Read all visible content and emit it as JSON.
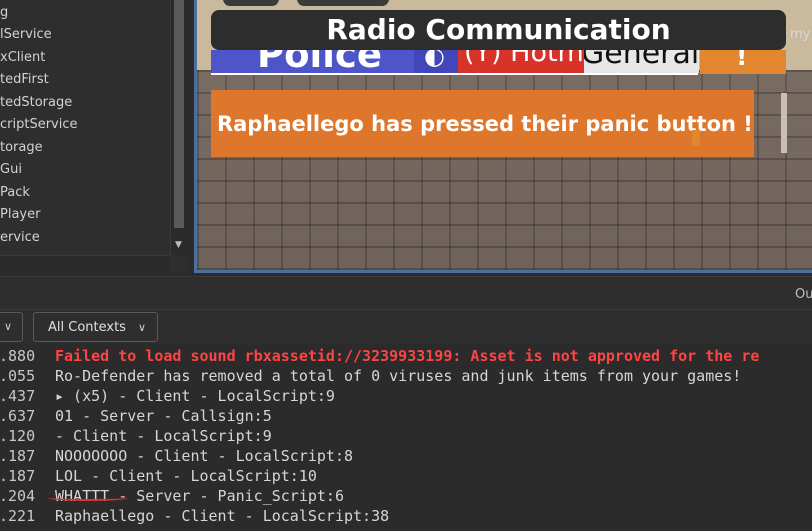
{
  "explorer": {
    "items": [
      "g",
      "lService",
      "xClient",
      "tedFirst",
      "tedStorage",
      "criptService",
      "torage",
      "Gui",
      "Pack",
      "Player",
      "ervice"
    ]
  },
  "viewport": {
    "title": "Radio Communication",
    "bg_right_text": "my",
    "tabs": {
      "police": "Police",
      "hotmic": "(Y) Hotmic",
      "general": "General",
      "alert": "!"
    },
    "panic_message": "Raphaellego has pressed their panic button !"
  },
  "output": {
    "header_label": "Ou",
    "filter_context": "All Contexts",
    "rows": [
      {
        "time": ".880",
        "msg": "Failed to load sound rbxassetid://3239933199: Asset is not approved for the re",
        "type": "error"
      },
      {
        "time": ".055",
        "msg": "Ro-Defender has removed a total of 0 viruses and junk items from your games!",
        "type": "normal"
      },
      {
        "time": ".437",
        "msg": " ▸  (x5)  -  Client - LocalScript:9",
        "type": "normal"
      },
      {
        "time": ".637",
        "msg": "01  -  Server - Callsign:5",
        "type": "normal"
      },
      {
        "time": ".120",
        "msg": "  -  Client - LocalScript:9",
        "type": "normal"
      },
      {
        "time": ".187",
        "msg": "NOOOOOOO  -  Client - LocalScript:8",
        "type": "normal"
      },
      {
        "time": ".187",
        "msg": "LOL  -  Client - LocalScript:10",
        "type": "normal"
      },
      {
        "time": ".204",
        "msg": "WHATTT  -  Server - Panic_Script:6",
        "type": "normal"
      },
      {
        "time": ".221",
        "msg": "Raphaellego  -  Client - LocalScript:38",
        "type": "normal"
      }
    ]
  },
  "colors": {
    "error": "#ff4444",
    "annotation": "#e03030"
  }
}
